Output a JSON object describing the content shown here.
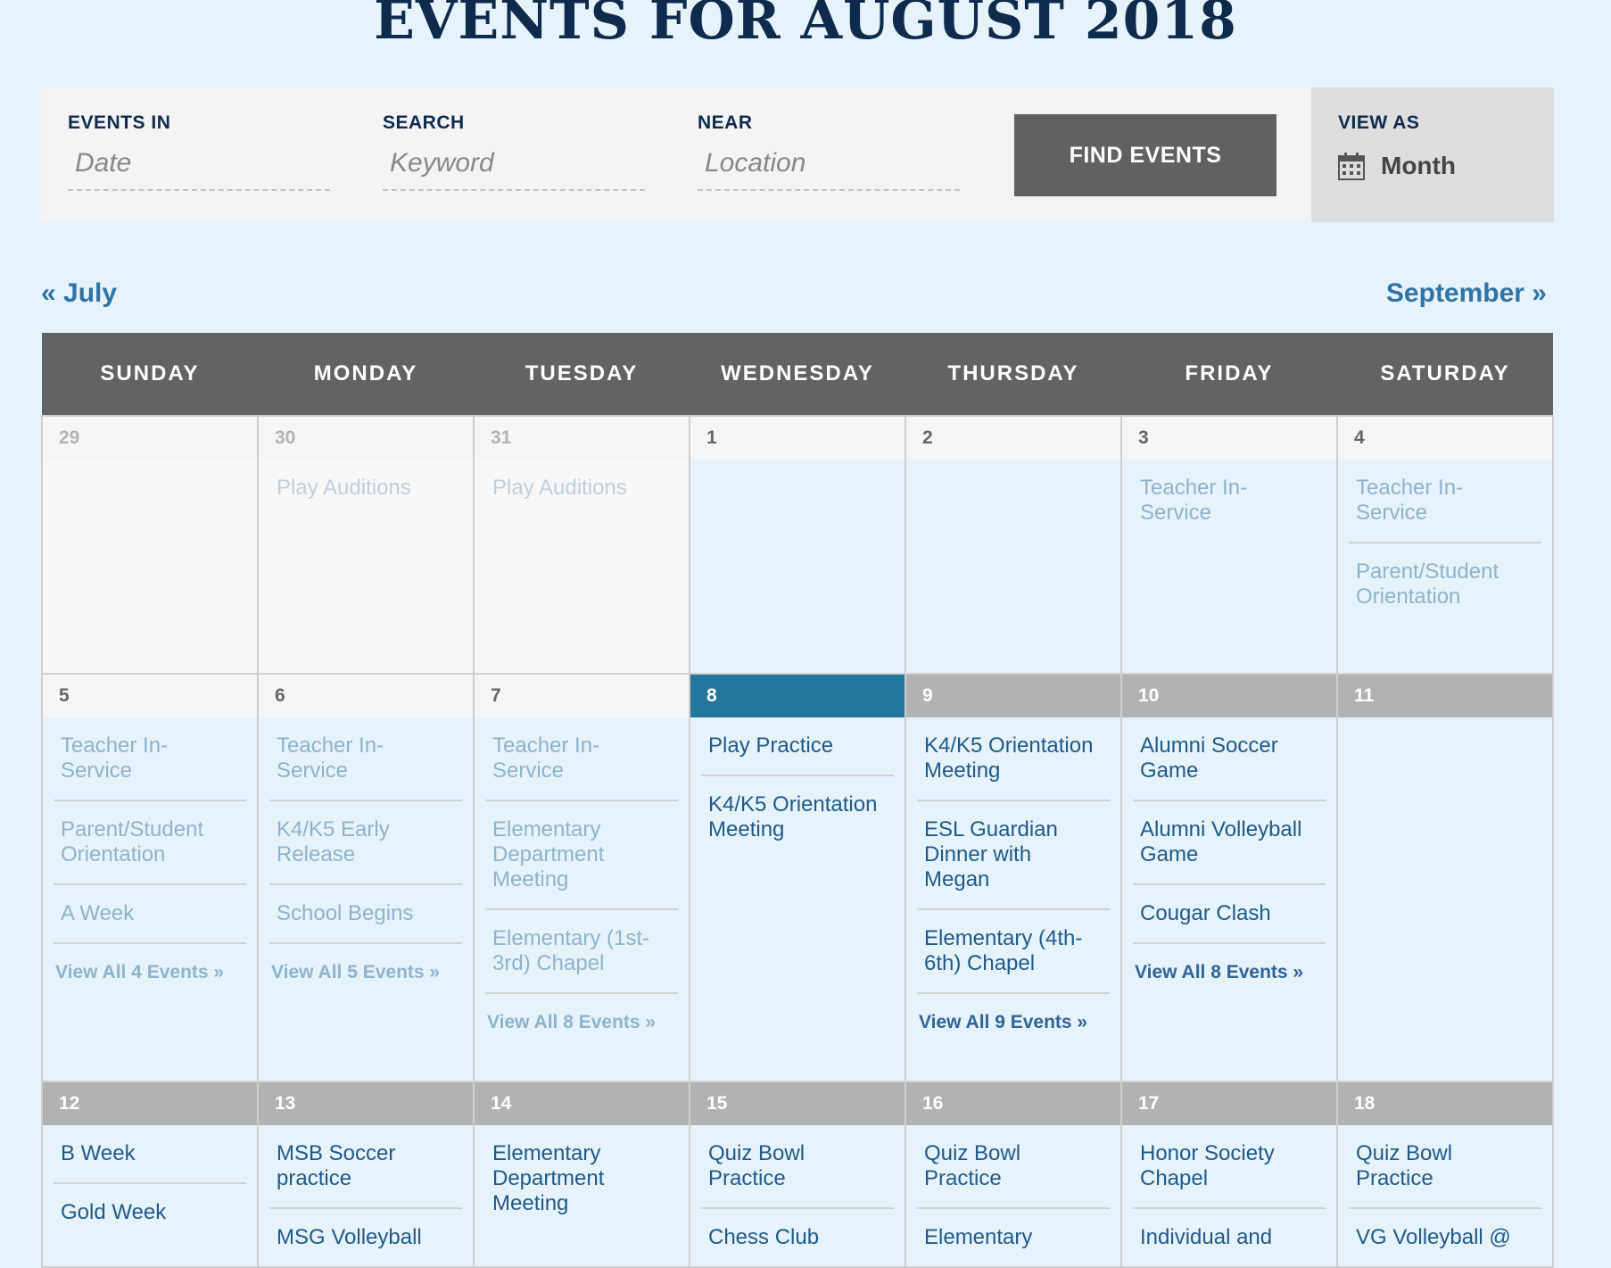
{
  "page": {
    "title": "EVENTS FOR AUGUST 2018",
    "colors": {
      "accent": "#25769c",
      "navy": "#0e2a4c",
      "header_bg": "#636363",
      "page_bg": "#e6f3fb"
    }
  },
  "filters": {
    "events_in": {
      "label": "EVENTS IN",
      "placeholder": "Date"
    },
    "search": {
      "label": "SEARCH",
      "placeholder": "Keyword"
    },
    "near": {
      "label": "NEAR",
      "placeholder": "Location"
    },
    "find_button": "FIND EVENTS",
    "view_as": {
      "label": "VIEW AS",
      "value": "Month",
      "icon": "calendar-icon"
    }
  },
  "nav": {
    "prev": "« July",
    "next": "September »"
  },
  "calendar": {
    "weekdays": [
      "SUNDAY",
      "MONDAY",
      "TUESDAY",
      "WEDNESDAY",
      "THURSDAY",
      "FRIDAY",
      "SATURDAY"
    ],
    "weeks": [
      [
        {
          "day": "29",
          "state": "past other",
          "events": []
        },
        {
          "day": "30",
          "state": "past other",
          "events": [
            "Play Auditions"
          ]
        },
        {
          "day": "31",
          "state": "past other",
          "events": [
            "Play Auditions"
          ]
        },
        {
          "day": "1",
          "state": "past cur",
          "events": []
        },
        {
          "day": "2",
          "state": "past cur",
          "events": []
        },
        {
          "day": "3",
          "state": "past cur",
          "events": [
            "Teacher In-Service"
          ]
        },
        {
          "day": "4",
          "state": "past cur",
          "events": [
            "Teacher In-Service",
            "Parent/Student Orientation"
          ]
        }
      ],
      [
        {
          "day": "5",
          "state": "past cur",
          "events": [
            "Teacher In-Service",
            "Parent/Student Orientation",
            "A Week"
          ],
          "view_all": "View All 4 Events »"
        },
        {
          "day": "6",
          "state": "past cur",
          "events": [
            "Teacher In-Service",
            "K4/K5 Early Release",
            "School Begins"
          ],
          "view_all": "View All 5 Events »"
        },
        {
          "day": "7",
          "state": "past cur",
          "events": [
            "Teacher In-Service",
            "Elementary Department Meeting",
            "Elementary (1st-3rd) Chapel"
          ],
          "view_all": "View All 8 Events »"
        },
        {
          "day": "8",
          "state": "today cur",
          "events": [
            "Play Practice",
            "K4/K5 Orientation Meeting"
          ]
        },
        {
          "day": "9",
          "state": "future cur",
          "events": [
            "K4/K5 Orientation Meeting",
            "ESL Guardian Dinner with Megan",
            "Elementary (4th-6th) Chapel"
          ],
          "view_all": "View All 9 Events »"
        },
        {
          "day": "10",
          "state": "future cur",
          "events": [
            "Alumni Soccer Game",
            "Alumni Volleyball Game",
            "Cougar Clash"
          ],
          "view_all": "View All 8 Events »"
        },
        {
          "day": "11",
          "state": "future cur",
          "events": []
        }
      ],
      [
        {
          "day": "12",
          "state": "future cur",
          "events": [
            "B Week",
            "Gold Week"
          ]
        },
        {
          "day": "13",
          "state": "future cur",
          "events": [
            "MSB Soccer practice",
            "MSG Volleyball"
          ]
        },
        {
          "day": "14",
          "state": "future cur",
          "events": [
            "Elementary Department Meeting"
          ]
        },
        {
          "day": "15",
          "state": "future cur",
          "events": [
            "Quiz Bowl Practice",
            "Chess Club"
          ]
        },
        {
          "day": "16",
          "state": "future cur",
          "events": [
            "Quiz Bowl Practice",
            "Elementary"
          ]
        },
        {
          "day": "17",
          "state": "future cur",
          "events": [
            "Honor Society Chapel",
            "Individual and"
          ]
        },
        {
          "day": "18",
          "state": "future cur",
          "events": [
            "Quiz Bowl Practice",
            "VG Volleyball @"
          ]
        }
      ]
    ]
  }
}
